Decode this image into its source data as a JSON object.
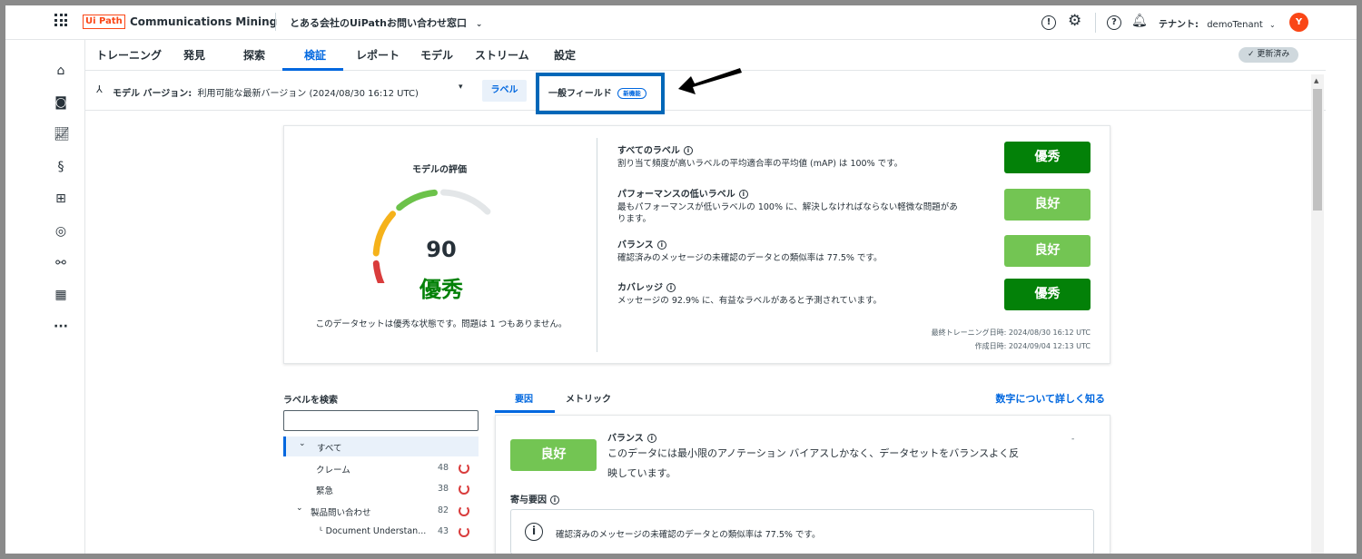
{
  "app": {
    "logo_text": "Ui Path",
    "product_name": "Communications Mining",
    "dataset_name": "とある会社のUiPathお問い合わせ窓口",
    "tenant_label": "テナント:",
    "tenant_name": "demoTenant",
    "avatar_letter": "Y",
    "updated_label": "✓ 更新済み"
  },
  "tabs": [
    "トレーニング",
    "発見",
    "探索",
    "検証",
    "レポート",
    "モデル",
    "ストリーム",
    "設定"
  ],
  "active_tab": "検証",
  "subbar": {
    "model_version_label": "モデル バージョン:",
    "model_version_value": "利用可能な最新バージョン (2024/08/30 16:12 UTC)",
    "labels_tab": "ラベル",
    "general_fields_tab": "一般フィールド",
    "new_badge": "新機能"
  },
  "score_card": {
    "title": "モデルの評価",
    "score": "90",
    "rating": "優秀",
    "summary": "このデータセットは優秀な状態です。問題は 1 つもありません。",
    "gauge_colors": [
      "#d93c3c",
      "#f5b21b",
      "#6cc24a",
      "#e3e6e8"
    ],
    "factors": [
      {
        "title": "すべてのラベル",
        "desc_line1": "割り当て頻度が高いラベルの平均適合率の平均値 (mAP) は 100% です。",
        "desc_line2": "",
        "rating": "優秀",
        "level": "excellent"
      },
      {
        "title": "パフォーマンスの低いラベル",
        "desc_line1": "最もパフォーマンスが低いラベルの 100% に、解決しなければならない軽微な問題があ",
        "desc_line2": "ります。",
        "rating": "良好",
        "level": "good"
      },
      {
        "title": "バランス",
        "desc_line1": "確認済みのメッセージの未確認のデータとの類似率は 77.5% です。",
        "desc_line2": "",
        "rating": "良好",
        "level": "good"
      },
      {
        "title": "カバレッジ",
        "desc_line1": "メッセージの 92.9% に、有益なラベルがあると予測されています。",
        "desc_line2": "",
        "rating": "優秀",
        "level": "excellent"
      }
    ],
    "last_trained": "最終トレーニング日時: 2024/08/30 16:12 UTC",
    "created": "作成日時: 2024/09/04 12:13 UTC"
  },
  "label_search": {
    "title": "ラベルを検索",
    "placeholder": "",
    "items": [
      {
        "name": "すべて",
        "count": "",
        "indent": 0,
        "expand": true,
        "selected": true
      },
      {
        "name": "クレーム",
        "count": "48",
        "indent": 1,
        "expand": false,
        "selected": false
      },
      {
        "name": "緊急",
        "count": "38",
        "indent": 1,
        "expand": false,
        "selected": false
      },
      {
        "name": "製品問い合わせ",
        "count": "82",
        "indent": 1,
        "expand": true,
        "selected": false
      },
      {
        "name": "ᒻ Document Understan...",
        "count": "43",
        "indent": 2,
        "expand": false,
        "selected": false
      }
    ]
  },
  "detail": {
    "tabs": [
      "要因",
      "メトリック"
    ],
    "learn_more": "数字について詳しく知る",
    "rating": "良好",
    "factor_title": "バランス",
    "factor_desc_line1": "このデータには最小限のアノテーション バイアスしかなく、データセットをバランスよく反",
    "factor_desc_line2": "映しています。",
    "contributing_title": "寄与要因",
    "contrib_text": "確認済みのメッセージの未確認のデータとの類似率は 77.5% です。"
  }
}
